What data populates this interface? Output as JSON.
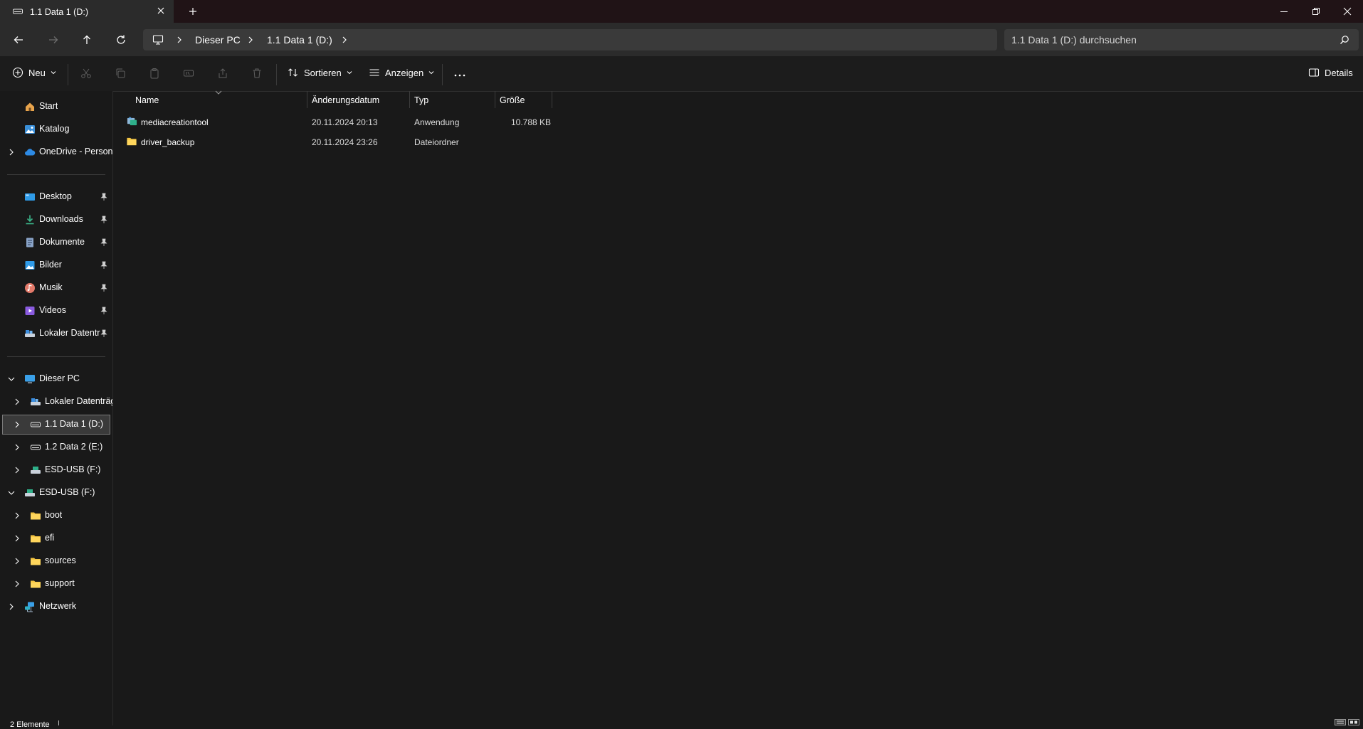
{
  "window": {
    "tab_title": "1.1 Data 1 (D:)"
  },
  "breadcrumb": {
    "items": [
      "Dieser PC",
      "1.1 Data 1 (D:)"
    ]
  },
  "search": {
    "placeholder": "1.1 Data 1 (D:) durchsuchen"
  },
  "toolbar": {
    "new_label": "Neu",
    "sort_label": "Sortieren",
    "view_label": "Anzeigen",
    "details_label": "Details"
  },
  "sidebar": {
    "quick": [
      {
        "label": "Start",
        "icon": "home-icon"
      },
      {
        "label": "Katalog",
        "icon": "gallery-icon"
      },
      {
        "label": "OneDrive - Persona",
        "icon": "cloud-icon"
      }
    ],
    "pinned": [
      {
        "label": "Desktop",
        "icon": "desktop-folder-icon"
      },
      {
        "label": "Downloads",
        "icon": "download-icon"
      },
      {
        "label": "Dokumente",
        "icon": "document-icon"
      },
      {
        "label": "Bilder",
        "icon": "pictures-icon"
      },
      {
        "label": "Musik",
        "icon": "music-icon"
      },
      {
        "label": "Videos",
        "icon": "video-icon"
      },
      {
        "label": "Lokaler Datenträ",
        "icon": "local-drive-icon"
      }
    ],
    "tree": [
      {
        "label": "Dieser PC",
        "icon": "pc-icon"
      },
      {
        "label": "Lokaler Datenträg",
        "icon": "local-drive-icon"
      },
      {
        "label": "1.1 Data 1 (D:)",
        "icon": "drive-icon"
      },
      {
        "label": "1.2 Data 2 (E:)",
        "icon": "drive-icon"
      },
      {
        "label": "ESD-USB (F:)",
        "icon": "usb-drive-icon"
      },
      {
        "label": "ESD-USB (F:)",
        "icon": "usb-drive-icon"
      },
      {
        "label": "boot",
        "icon": "folder-icon"
      },
      {
        "label": "efi",
        "icon": "folder-icon"
      },
      {
        "label": "sources",
        "icon": "folder-icon"
      },
      {
        "label": "support",
        "icon": "folder-icon"
      },
      {
        "label": "Netzwerk",
        "icon": "network-icon"
      }
    ]
  },
  "columns": {
    "name": "Name",
    "date": "Änderungsdatum",
    "type": "Typ",
    "size": "Größe"
  },
  "files": [
    {
      "name": "mediacreationtool",
      "date": "20.11.2024 20:13",
      "type": "Anwendung",
      "size": "10.788 KB",
      "icon": "app-icon"
    },
    {
      "name": "driver_backup",
      "date": "20.11.2024 23:26",
      "type": "Dateiordner",
      "size": "",
      "icon": "folder-icon"
    }
  ],
  "status": {
    "count": "2 Elemente"
  },
  "colors": {
    "accent_folder": "#f4c542",
    "background": "#191919",
    "titlebar": "#201316"
  }
}
